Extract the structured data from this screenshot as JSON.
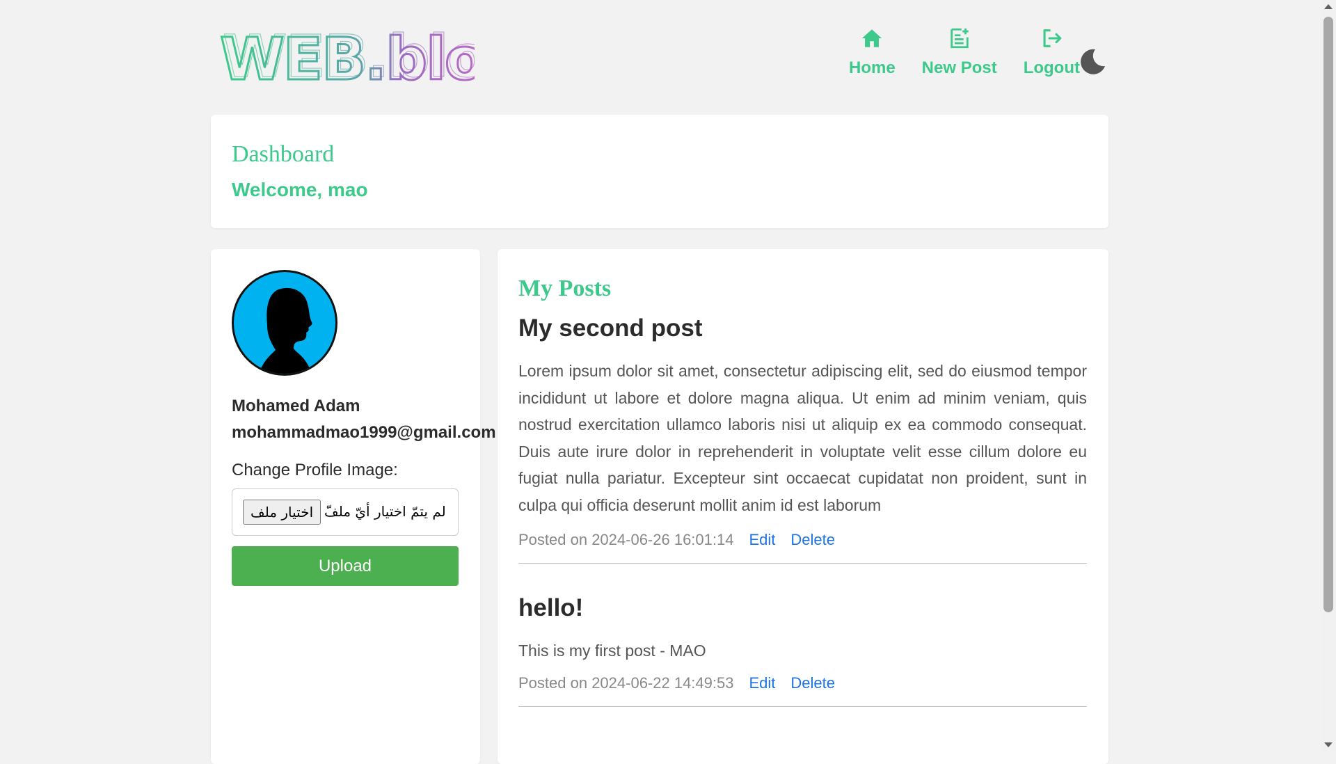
{
  "header": {
    "logo_text": "WEB.blog",
    "nav": [
      {
        "label": "Home",
        "icon": "home-icon"
      },
      {
        "label": "New Post",
        "icon": "new-post-icon"
      },
      {
        "label": "Logout",
        "icon": "logout-icon"
      }
    ],
    "theme_toggle_icon": "moon-icon"
  },
  "dashboard": {
    "title": "Dashboard",
    "welcome": "Welcome, mao"
  },
  "profile": {
    "name": "Mohamed Adam",
    "email": "mohammadmao1999@gmail.com",
    "change_image_label": "Change Profile Image:",
    "file_button_label": "اختيار ملف",
    "file_status": "لم يتمّ اختيار أيّ ملفّ",
    "upload_label": "Upload"
  },
  "posts": {
    "title": "My Posts",
    "items": [
      {
        "title": "My second post",
        "body": "Lorem ipsum dolor sit amet, consectetur adipiscing elit, sed do eiusmod tempor incididunt ut labore et dolore magna aliqua. Ut enim ad minim veniam, quis nostrud exercitation ullamco laboris nisi ut aliquip ex ea commodo consequat. Duis aute irure dolor in reprehenderit in voluptate velit esse cillum dolore eu fugiat nulla pariatur. Excepteur sint occaecat cupidatat non proident, sunt in culpa qui officia deserunt mollit anim id est laborum",
        "meta": "Posted on 2024-06-26 16:01:14",
        "edit_label": "Edit",
        "delete_label": "Delete"
      },
      {
        "title": "hello!",
        "body": "This is my first post - MAO",
        "meta": "Posted on 2024-06-22 14:49:53",
        "edit_label": "Edit",
        "delete_label": "Delete"
      }
    ]
  },
  "colors": {
    "accent": "#3cc98b",
    "upload": "#4caf50",
    "link": "#1a73e8",
    "avatar_bg": "#00b2ef"
  }
}
